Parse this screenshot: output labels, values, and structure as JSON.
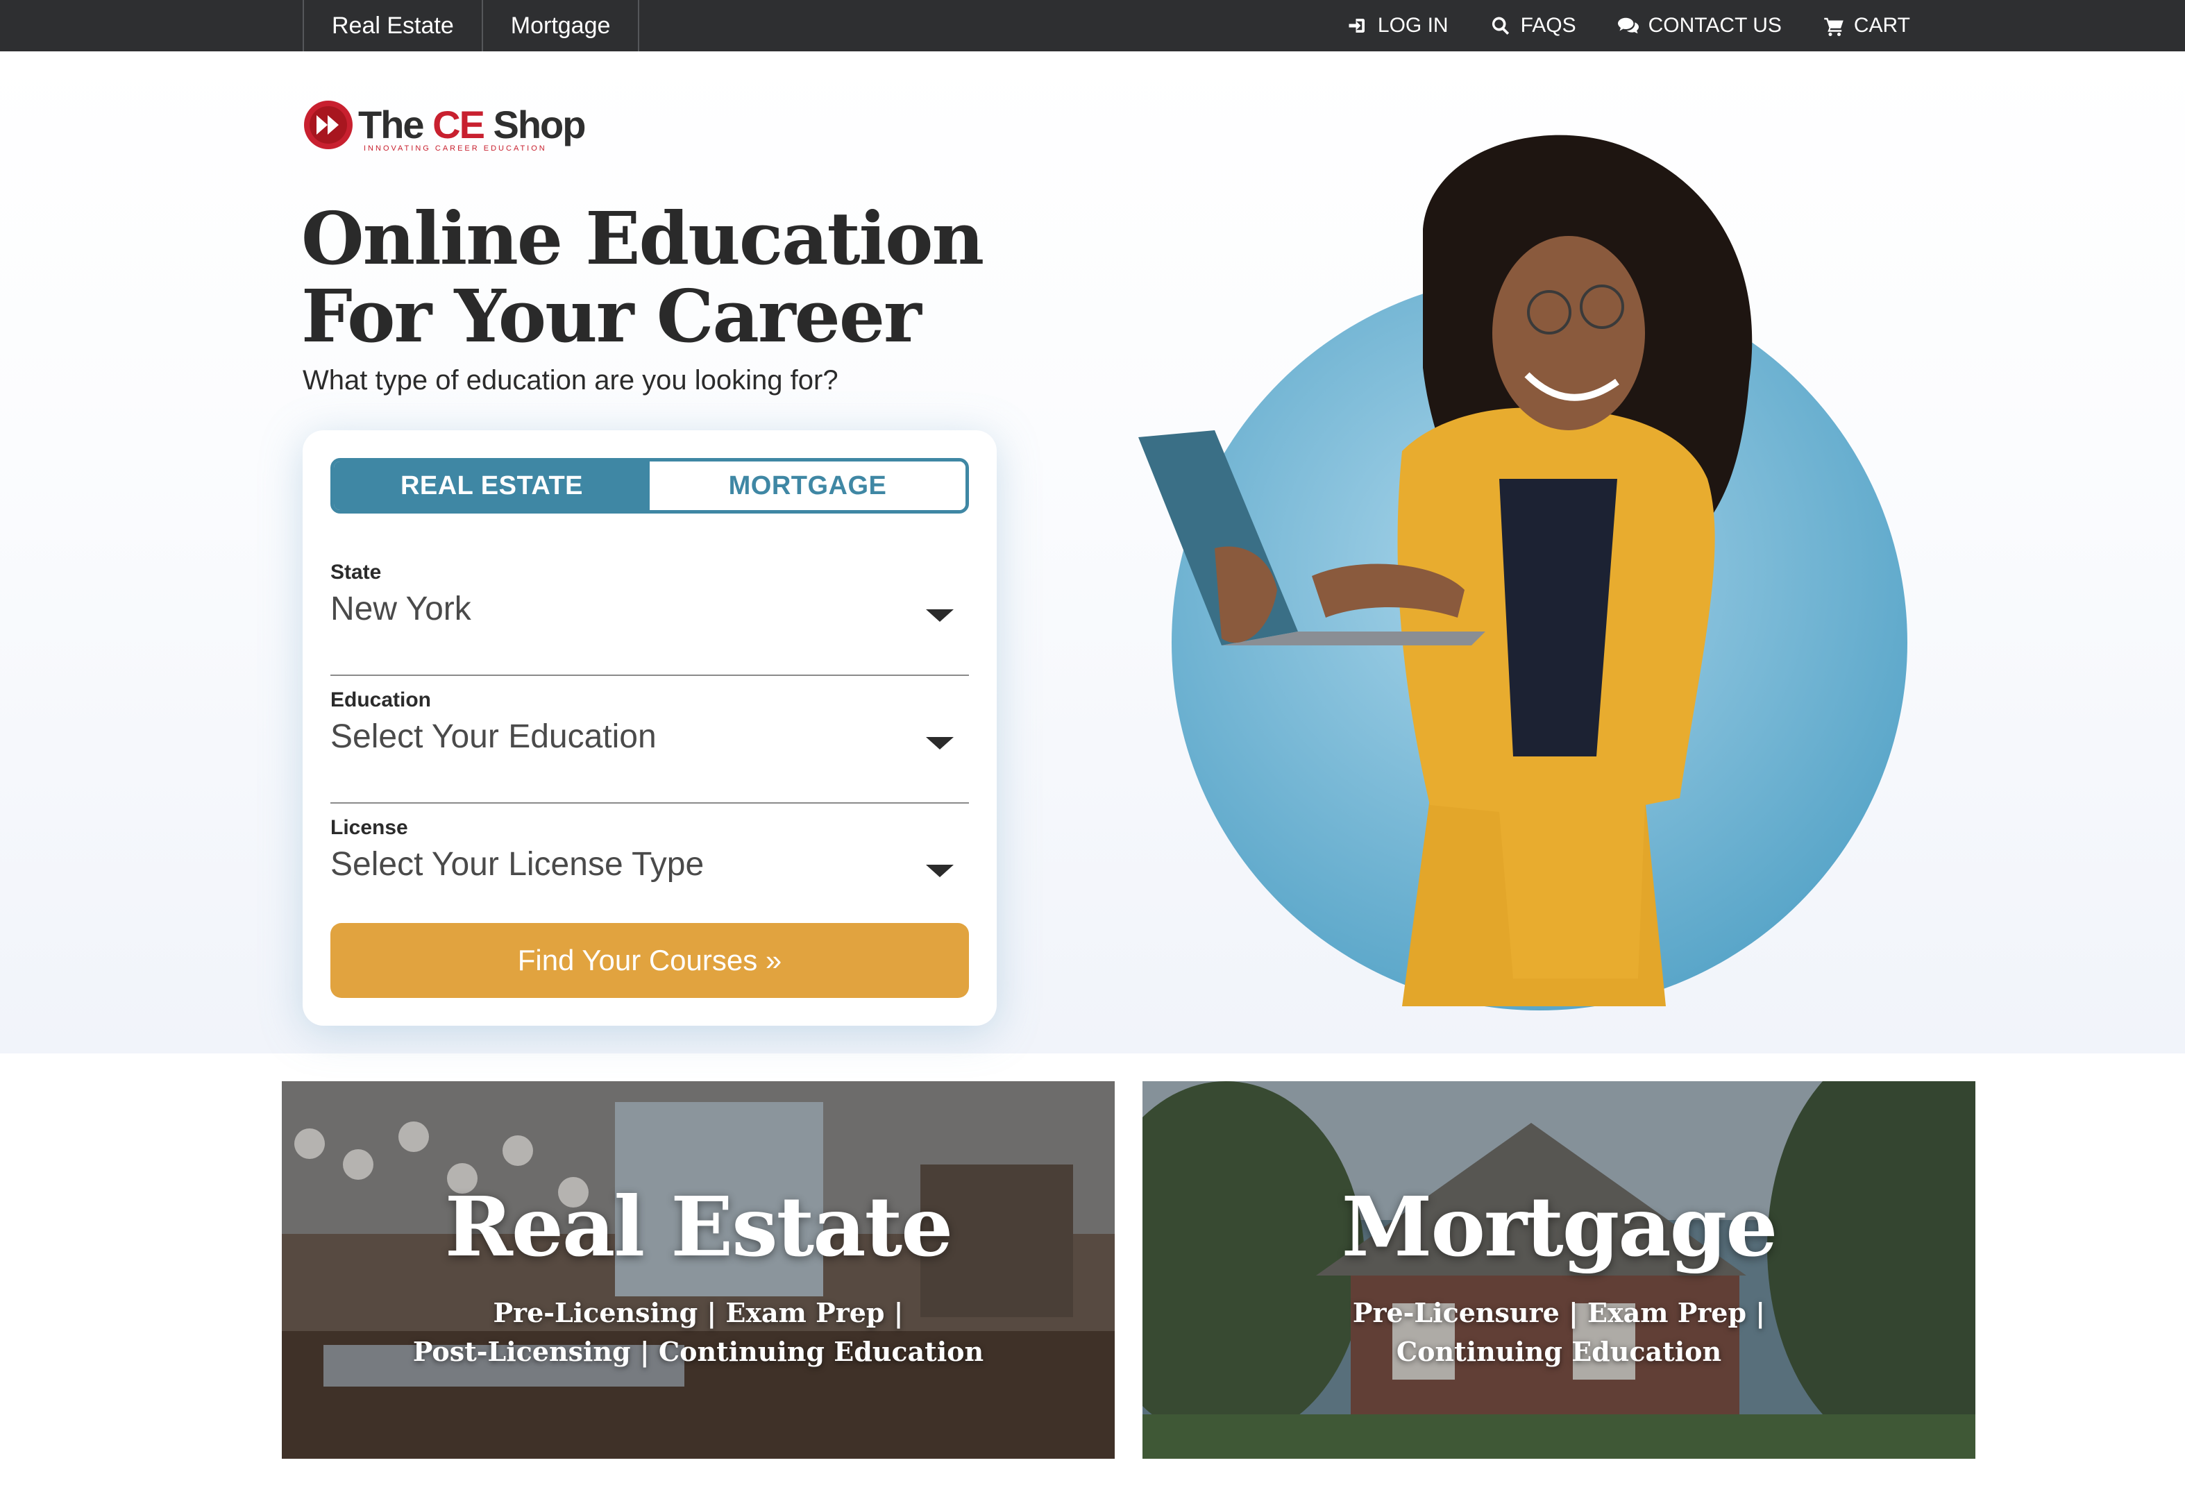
{
  "topbar": {
    "tabs": [
      {
        "label": "Real Estate"
      },
      {
        "label": "Mortgage"
      }
    ],
    "links": [
      {
        "label": "LOG IN",
        "icon": "login-icon"
      },
      {
        "label": "FAQS",
        "icon": "search-icon"
      },
      {
        "label": "CONTACT US",
        "icon": "chat-icon"
      },
      {
        "label": "CART",
        "icon": "cart-icon"
      }
    ]
  },
  "brand": {
    "name_prefix": "The ",
    "name_accent": "CE",
    "name_suffix": " Shop",
    "tagline": "INNOVATING CAREER EDUCATION",
    "accent_color": "#c8202f"
  },
  "hero": {
    "headline_line1": "Online Education",
    "headline_line2": "For Your Career",
    "subhead": "What type of education are you looking for?"
  },
  "search": {
    "toggle": [
      {
        "label": "REAL ESTATE",
        "active": true
      },
      {
        "label": "MORTGAGE",
        "active": false
      }
    ],
    "fields": [
      {
        "label": "State",
        "value": "New York"
      },
      {
        "label": "Education",
        "value": "Select Your Education"
      },
      {
        "label": "License",
        "value": "Select Your License Type"
      }
    ],
    "submit_label": "Find Your Courses »",
    "colors": {
      "toggle": "#3f87a4",
      "button": "#e1a33f"
    }
  },
  "tiles": [
    {
      "title": "Real Estate",
      "sub_line1": "Pre-Licensing | Exam Prep |",
      "sub_line2": "Post-Licensing | Continuing Education"
    },
    {
      "title": "Mortgage",
      "sub_line1": "Pre-Licensure | Exam Prep |",
      "sub_line2": "Continuing Education"
    }
  ]
}
